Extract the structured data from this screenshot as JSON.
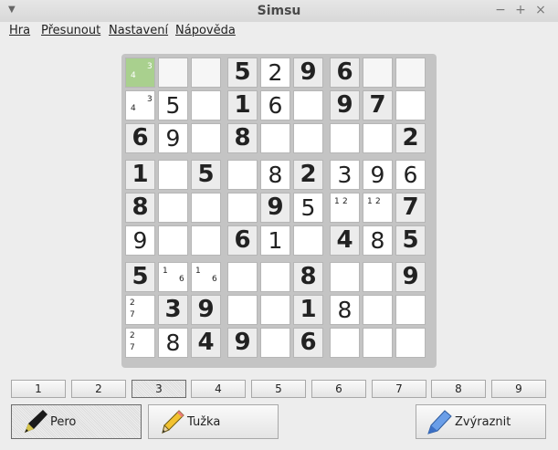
{
  "window": {
    "title": "Simsu"
  },
  "menu": [
    "Hra",
    "Přesunout",
    "Nastavení",
    "Nápověda"
  ],
  "board": {
    "rows": [
      [
        {
          "n": [
            "4",
            "3"
          ]
        },
        {},
        {},
        {
          "v": "5",
          "g": true
        },
        {
          "v": "2"
        },
        {
          "v": "9",
          "g": true
        },
        {
          "v": "6",
          "g": true
        },
        {},
        {}
      ],
      [
        {
          "n": [
            "4",
            "3"
          ]
        },
        {
          "v": "5"
        },
        {},
        {
          "v": "1",
          "g": true
        },
        {
          "v": "6"
        },
        {},
        {
          "v": "9",
          "g": true
        },
        {
          "v": "7",
          "g": true
        },
        {}
      ],
      [
        {
          "v": "6",
          "g": true
        },
        {
          "v": "9"
        },
        {},
        {
          "v": "8",
          "g": true
        },
        {},
        {},
        {},
        {},
        {
          "v": "2",
          "g": true
        }
      ],
      [
        {
          "v": "1",
          "g": true
        },
        {},
        {
          "v": "5",
          "g": true
        },
        {},
        {
          "v": "8"
        },
        {
          "v": "2",
          "g": true
        },
        {
          "v": "3"
        },
        {
          "v": "9"
        },
        {
          "v": "6"
        }
      ],
      [
        {
          "v": "8",
          "g": true
        },
        {},
        {},
        {},
        {
          "v": "9",
          "g": true
        },
        {
          "v": "5"
        },
        {
          "n": [
            "1",
            "2"
          ]
        },
        {
          "n": [
            "1",
            "2"
          ]
        },
        {
          "v": "7",
          "g": true
        }
      ],
      [
        {
          "v": "9"
        },
        {},
        {},
        {
          "v": "6",
          "g": true
        },
        {
          "v": "1"
        },
        {},
        {
          "v": "4",
          "g": true
        },
        {
          "v": "8"
        },
        {
          "v": "5",
          "g": true
        }
      ],
      [
        {
          "v": "5",
          "g": true
        },
        {
          "n": [
            "1",
            "6"
          ]
        },
        {
          "n": [
            "1",
            "6"
          ]
        },
        {},
        {},
        {
          "v": "8",
          "g": true
        },
        {},
        {},
        {
          "v": "9",
          "g": true
        }
      ],
      [
        {
          "n": [
            "2",
            "7"
          ]
        },
        {
          "v": "3",
          "g": true
        },
        {
          "v": "9",
          "g": true
        },
        {},
        {},
        {
          "v": "1",
          "g": true
        },
        {
          "v": "8"
        },
        {},
        {}
      ],
      [
        {
          "n": [
            "2",
            "7"
          ]
        },
        {
          "v": "8"
        },
        {
          "v": "4",
          "g": true
        },
        {
          "v": "9",
          "g": true
        },
        {},
        {
          "v": "6",
          "g": true
        },
        {},
        {},
        {}
      ]
    ],
    "selected": [
      0,
      0
    ],
    "colors": {
      "selected": "#a9d08e",
      "given": "#ececec"
    }
  },
  "number_buttons": [
    "1",
    "2",
    "3",
    "4",
    "5",
    "6",
    "7",
    "8",
    "9"
  ],
  "active_number": 2,
  "tools": {
    "pen": {
      "label": "Pero",
      "icon": "pen-icon"
    },
    "pencil": {
      "label": "Tužka",
      "icon": "pencil-icon"
    },
    "highlight": {
      "label": "Zvýraznit",
      "icon": "highlighter-icon"
    }
  }
}
